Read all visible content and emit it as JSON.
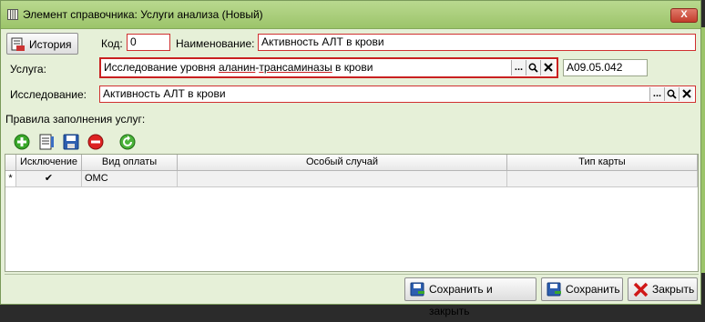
{
  "window": {
    "title": "Элемент справочника: Услуги анализа (Новый)",
    "close_label": "X"
  },
  "header": {
    "history_button": "История",
    "code_label": "Код:",
    "code_value": "0",
    "name_label": "Наименование:",
    "name_value": "Активность АЛТ в крови"
  },
  "service": {
    "label": "Услуга:",
    "value_prefix": "Исследование уровня ",
    "value_underlined_1": "аланин",
    "value_dash": "-",
    "value_underlined_2": "трансаминазы",
    "value_suffix": " в крови",
    "code": "A09.05.042",
    "btn_more": "...",
    "btn_search": "Q",
    "btn_clear": "X"
  },
  "research": {
    "label": "Исследование:",
    "value": "Активность АЛТ в крови",
    "btn_more": "...",
    "btn_search": "Q",
    "btn_clear": "X"
  },
  "rules": {
    "label": "Правила заполнения услуг:"
  },
  "grid": {
    "columns": [
      "Исключение",
      "Вид оплаты",
      "Особый случай",
      "Тип карты"
    ],
    "rows": [
      {
        "marker": "*",
        "exclusion": "✔",
        "payment_type": "ОМС",
        "special_case": "",
        "card_type": ""
      }
    ]
  },
  "footer": {
    "save_close": "Сохранить и закрыть",
    "save": "Сохранить",
    "close": "Закрыть"
  },
  "colors": {
    "title_bar": "#9cc46a",
    "window_bg": "#e6f0d8",
    "required_border": "#d03030"
  }
}
